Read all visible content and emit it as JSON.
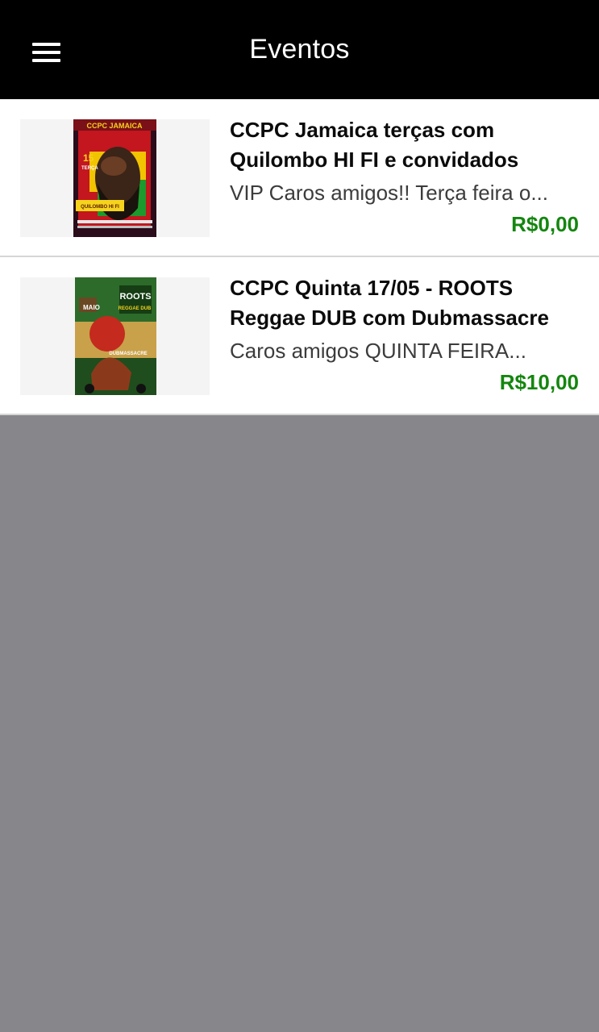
{
  "header": {
    "title": "Eventos",
    "menu_icon": "hamburger-menu-icon"
  },
  "events": [
    {
      "title": "CCPC Jamaica terças com Quilombo HI FI e convidados",
      "description": "VIP Caros amigos!! Terça feira o...",
      "price": "R$0,00",
      "poster": {
        "header_text": "CCPC JAMAICA",
        "date_number": "15",
        "date_word": "TERÇA",
        "highlight_text": "QUILOMBO HI FI"
      }
    },
    {
      "title": "CCPC Quinta 17/05 - ROOTS Reggae DUB com Dubmassacre",
      "description": "Caros amigos QUINTA FEIRA...",
      "price": "R$10,00",
      "poster": {
        "header_text": "ROOTS",
        "subheader_text": "REGGAE DUB",
        "month_text": "MAIO",
        "highlight_text": "DUBMASSACRE"
      }
    }
  ],
  "colors": {
    "topbar": "#000000",
    "price": "#14860f",
    "background": "#87878b"
  }
}
